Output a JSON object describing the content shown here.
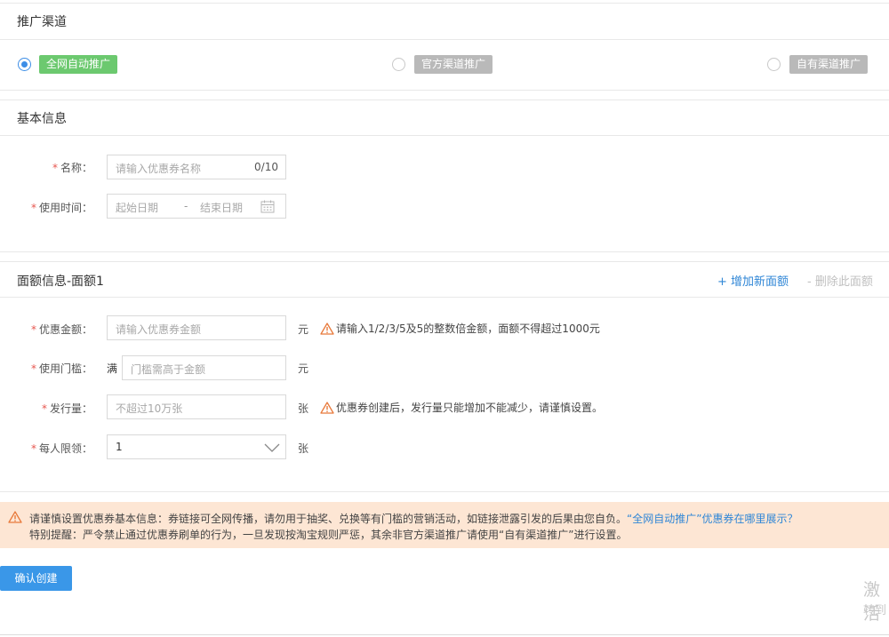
{
  "channel": {
    "title": "推广渠道",
    "options": [
      {
        "label": "全网自动推广",
        "selected": true,
        "color": "#6cc96f"
      },
      {
        "label": "官方渠道推广",
        "selected": false,
        "color": "#b9b9b9"
      },
      {
        "label": "自有渠道推广",
        "selected": false,
        "color": "#b9b9b9"
      }
    ]
  },
  "basic": {
    "title": "基本信息",
    "name_label": "名称：",
    "name_placeholder": "请输入优惠券名称",
    "name_counter": "0/10",
    "time_label": "使用时间：",
    "start_placeholder": "起始日期",
    "separator": "-",
    "end_placeholder": "结束日期"
  },
  "denomination": {
    "title": "面额信息-面额1",
    "add_link": "+ 增加新面额",
    "delete_link": "- 删除此面额",
    "amount_label": "优惠金额：",
    "amount_placeholder": "请输入优惠券金额",
    "amount_unit": "元",
    "amount_hint": "请输入1/2/3/5及5的整数倍金额，面额不得超过1000元",
    "threshold_label": "使用门槛：",
    "threshold_prefix": "满",
    "threshold_placeholder": "门槛需高于金额",
    "threshold_unit": "元",
    "issue_label": "发行量：",
    "issue_placeholder": "不超过10万张",
    "issue_unit": "张",
    "issue_hint": "优惠券创建后，发行量只能增加不能减少，请谨慎设置。",
    "limit_label": "每人限领：",
    "limit_value": "1",
    "limit_unit": "张"
  },
  "notice": {
    "line1": "请谨慎设置优惠券基本信息：券链接可全网传播，请勿用于抽奖、兑换等有门槛的营销活动，如链接泄露引发的后果由您自负。",
    "line1_link": "“全网自动推广”优惠券在哪里展示？",
    "line2": "特别提醒：严令禁止通过优惠券刷单的行为，一旦发现按淘宝规则严惩，其余非官方渠道推广请使用“自有渠道推广”进行设置。"
  },
  "submit_label": "确认创建",
  "watermark": {
    "line1": "激活",
    "line2": "转到"
  },
  "required_mark": "*"
}
